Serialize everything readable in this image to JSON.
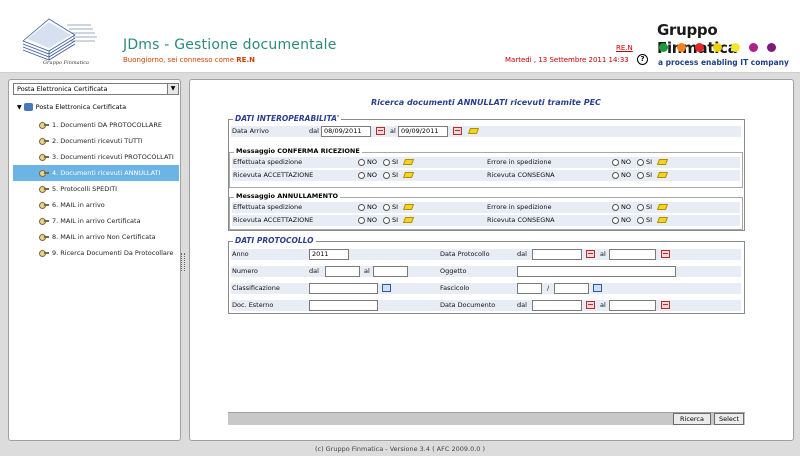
{
  "header": {
    "logo_caption": "Gruppo Finmatica",
    "app_title": "JDms - Gestione documentale",
    "greeting_prefix": "Buongiorno, sei connesso come",
    "greeting_user": "RE.N",
    "user_link": "RE.N",
    "datetime": "Martedi   , 13 Settembre 2011 14:33",
    "help_label": "?",
    "brand_name": "Gruppo Finmatica",
    "brand_tagline": "a process enabling IT company",
    "brand_dot_colors": [
      "#1f9a3a",
      "#f08020",
      "#e02828",
      "#f0d000",
      "#f0e830",
      "#b0208a",
      "#7a1a7a"
    ]
  },
  "sidebar": {
    "combo_value": "Posta Elettronica Certificata",
    "root_label": "Posta Elettronica Certificata",
    "items": [
      {
        "label": "1. Documenti DA PROTOCOLLARE"
      },
      {
        "label": "2. Documenti ricevuti TUTTI"
      },
      {
        "label": "3. Documenti ricevuti PROTOCOLLATI"
      },
      {
        "label": "4. Documenti ricevuti ANNULLATI",
        "active": true
      },
      {
        "label": "5. Protocolli SPEDITI"
      },
      {
        "label": "6. MAIL in arrivo"
      },
      {
        "label": "7. MAIL in arrivo Certificata"
      },
      {
        "label": "8. MAIL in arrivo Non Certificata"
      },
      {
        "label": "9. Ricerca Documenti Da Protocollare"
      }
    ]
  },
  "main": {
    "title": "Ricerca documenti ANNULLATI ricevuti tramite PEC",
    "interop": {
      "legend": "DATI INTEROPERABILITA'",
      "data_arrivo_label": "Data Arrivo",
      "dal_label": "dal",
      "dal_value": "08/09/2011",
      "al_label": "al",
      "al_value": "09/09/2011",
      "conferma": {
        "legend": "Messaggio CONFERMA RICEZIONE",
        "effettuata_label": "Effettuata spedizione",
        "errore_label": "Errore in spedizione",
        "ricevuta_acc_label": "Ricevuta ACCETTAZIONE",
        "ricevuta_cons_label": "Ricevuta CONSEGNA"
      },
      "annullamento": {
        "legend": "Messaggio ANNULLAMENTO",
        "effettuata_label": "Effettuata spedizione",
        "errore_label": "Errore in spedizione",
        "ricevuta_acc_label": "Ricevuta ACCETTAZIONE",
        "ricevuta_cons_label": "Ricevuta CONSEGNA"
      },
      "no_label": "NO",
      "si_label": "SI"
    },
    "protocollo": {
      "legend": "DATI PROTOCOLLO",
      "anno_label": "Anno",
      "anno_value": "2011",
      "data_protocollo_label": "Data Protocollo",
      "numero_label": "Numero",
      "oggetto_label": "Oggetto",
      "classificazione_label": "Classificazione",
      "fascicolo_label": "Fascicolo",
      "fascicolo_sep": "/",
      "doc_esterno_label": "Doc. Esterno",
      "data_documento_label": "Data Documento",
      "dal_label": "dal",
      "al_label": "al"
    },
    "buttons": {
      "ricerca": "Ricerca",
      "select": "Select"
    }
  },
  "footer": {
    "text": "(c) Gruppo Finmatica - Versione 3.4  ( AFC 2009.0.0 )"
  }
}
